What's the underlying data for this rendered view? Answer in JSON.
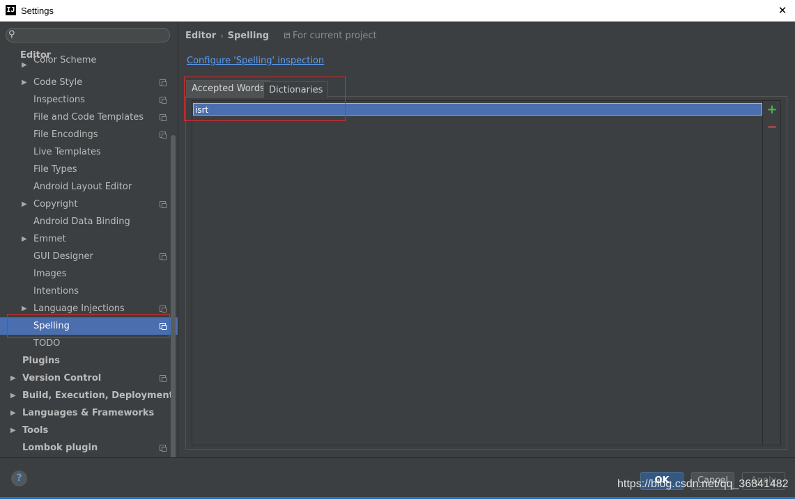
{
  "window": {
    "title": "Settings",
    "app_icon": "IJ"
  },
  "sidebar": {
    "search_placeholder": "",
    "section_label": "Editor",
    "items": [
      {
        "label": "Color Scheme",
        "expandable": true,
        "project_level": false
      },
      {
        "label": "Code Style",
        "expandable": true,
        "project_level": true
      },
      {
        "label": "Inspections",
        "expandable": false,
        "project_level": true
      },
      {
        "label": "File and Code Templates",
        "expandable": false,
        "project_level": true
      },
      {
        "label": "File Encodings",
        "expandable": false,
        "project_level": true
      },
      {
        "label": "Live Templates",
        "expandable": false,
        "project_level": false
      },
      {
        "label": "File Types",
        "expandable": false,
        "project_level": false
      },
      {
        "label": "Android Layout Editor",
        "expandable": false,
        "project_level": false
      },
      {
        "label": "Copyright",
        "expandable": true,
        "project_level": true
      },
      {
        "label": "Android Data Binding",
        "expandable": false,
        "project_level": false
      },
      {
        "label": "Emmet",
        "expandable": true,
        "project_level": false
      },
      {
        "label": "GUI Designer",
        "expandable": false,
        "project_level": true
      },
      {
        "label": "Images",
        "expandable": false,
        "project_level": false
      },
      {
        "label": "Intentions",
        "expandable": false,
        "project_level": false
      },
      {
        "label": "Language Injections",
        "expandable": true,
        "project_level": true
      },
      {
        "label": "Spelling",
        "expandable": false,
        "project_level": true,
        "selected": true
      },
      {
        "label": "TODO",
        "expandable": false,
        "project_level": false
      }
    ],
    "top_items": [
      {
        "label": "Plugins",
        "expandable": false,
        "project_level": false
      },
      {
        "label": "Version Control",
        "expandable": true,
        "project_level": true
      },
      {
        "label": "Build, Execution, Deployment",
        "expandable": true,
        "project_level": false
      },
      {
        "label": "Languages & Frameworks",
        "expandable": true,
        "project_level": false
      },
      {
        "label": "Tools",
        "expandable": true,
        "project_level": false
      },
      {
        "label": "Lombok plugin",
        "expandable": false,
        "project_level": true
      }
    ]
  },
  "content": {
    "breadcrumb": {
      "parent": "Editor",
      "separator": "›",
      "current": "Spelling",
      "scope": "For current project"
    },
    "configure_link": "Configure 'Spelling' inspection",
    "tabs": [
      {
        "label": "Accepted Words",
        "active": true
      },
      {
        "label": "Dictionaries",
        "active": false
      }
    ],
    "accepted_words": [
      "isrt"
    ],
    "add_glyph": "+",
    "remove_glyph": "−"
  },
  "footer": {
    "help_glyph": "?",
    "ok_label": "OK",
    "cancel_label": "Cancel",
    "apply_label": "Apply",
    "watermark": "https://blog.csdn.net/qq_36841482"
  },
  "colors": {
    "background": "#3c3f41",
    "selection": "#4b6eaf",
    "link": "#589df6",
    "highlight_box": "#e0282a"
  }
}
